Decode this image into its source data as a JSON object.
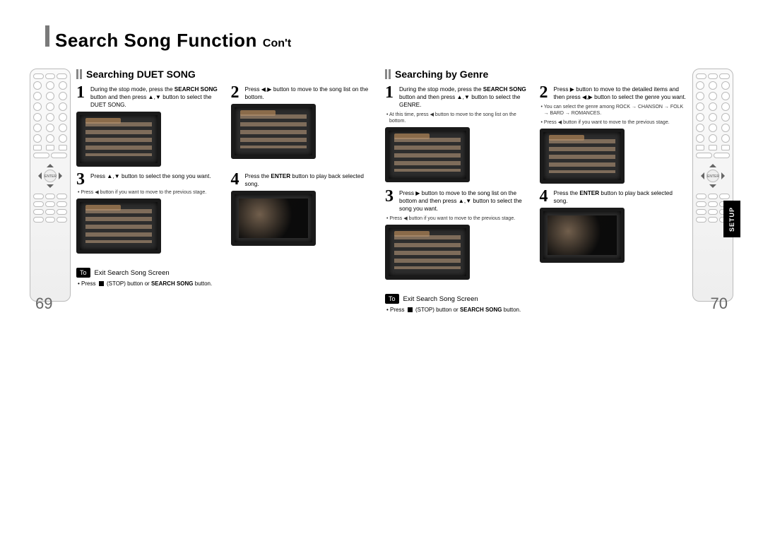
{
  "title": {
    "main": "Search Song Function",
    "cont": "Con't"
  },
  "page_left": "69",
  "page_right": "70",
  "side_tab": "SETUP",
  "glyphs": {
    "left": "◀",
    "right": "▶",
    "up": "▲",
    "down": "▼",
    "updn": "▲,▼",
    "lr": "◀,▶"
  },
  "duet": {
    "heading": "Searching DUET SONG",
    "steps": [
      {
        "num": "1",
        "html": "During the stop mode, press the <b>SEARCH SONG</b> button and then press ▲,▼ button to select the DUET SONG."
      },
      {
        "num": "2",
        "html": "Press ◀,▶ button to move to the song list on the bottom."
      },
      {
        "num": "3",
        "html": "Press ▲,▼ button to select the song you want.",
        "note": "Press ◀ button if you want to move to the previous stage."
      },
      {
        "num": "4",
        "html": "Press the <b>ENTER</b> button to play back selected song."
      }
    ],
    "exit": {
      "label": "To",
      "text": "Exit Search Song Screen",
      "note_pre": "Press",
      "note_post": "(STOP) button or <b>SEARCH SONG</b> button."
    }
  },
  "genre": {
    "heading": "Searching by Genre",
    "steps": [
      {
        "num": "1",
        "html": "During the stop mode, press the <b>SEARCH SONG</b> button and then press ▲,▼ button to select the GENRE.",
        "note": "At this time, press ◀ button to move to the song list on the bottom."
      },
      {
        "num": "2",
        "html": "Press ▶ button to move to the detailed items and then press ◀,▶ button to select the genre you want.",
        "note": "You can select the genre among ROCK → CHANSON → FOLK → BARD → ROMANCES.",
        "note2": "Press ◀ button if you want to move to the previous stage."
      },
      {
        "num": "3",
        "html": "Press ▶ button to move to the song list on the bottom and then press ▲,▼ button to select the song you want.",
        "note": "Press ◀ button if you want to move to the previous stage."
      },
      {
        "num": "4",
        "html": "Press the <b>ENTER</b> button to play back selected song."
      }
    ],
    "exit": {
      "label": "To",
      "text": "Exit Search Song Screen",
      "note_pre": "Press",
      "note_post": "(STOP) button or <b>SEARCH SONG</b> button."
    }
  }
}
